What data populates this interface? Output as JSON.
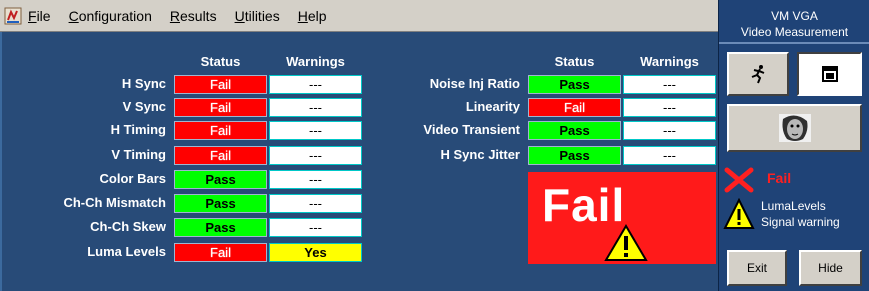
{
  "menu": {
    "items": [
      {
        "u": "F",
        "rest": "ile"
      },
      {
        "u": "C",
        "rest": "onfiguration"
      },
      {
        "u": "R",
        "rest": "esults"
      },
      {
        "u": "U",
        "rest": "tilities"
      },
      {
        "u": "H",
        "rest": "elp"
      }
    ]
  },
  "headers": {
    "status": "Status",
    "warnings": "Warnings"
  },
  "left_rows": [
    {
      "label": "H Sync",
      "status": "Fail",
      "warning": "---"
    },
    {
      "label": "V Sync",
      "status": "Fail",
      "warning": "---"
    },
    {
      "label": "H Timing",
      "status": "Fail",
      "warning": "---"
    },
    {
      "label": "V Timing",
      "status": "Fail",
      "warning": "---"
    },
    {
      "label": "Color Bars",
      "status": "Pass",
      "warning": "---"
    },
    {
      "label": "Ch-Ch Mismatch",
      "status": "Pass",
      "warning": "---"
    },
    {
      "label": "Ch-Ch Skew",
      "status": "Pass",
      "warning": "---"
    },
    {
      "label": "Luma Levels",
      "status": "Fail",
      "warning": "Yes"
    }
  ],
  "right_rows": [
    {
      "label": "Noise Inj Ratio",
      "status": "Pass",
      "warning": "---"
    },
    {
      "label": "Linearity",
      "status": "Fail",
      "warning": "---"
    },
    {
      "label": "Video Transient",
      "status": "Pass",
      "warning": "---"
    },
    {
      "label": "H Sync Jitter",
      "status": "Pass",
      "warning": "---"
    }
  ],
  "overall": {
    "result": "Fail"
  },
  "side_panel": {
    "title_line1": "VM VGA",
    "title_line2": "Video Measurement",
    "run_icon": "running-man-icon",
    "window_icon": "window-icon",
    "face_icon": "face-icon",
    "status_text": "Fail",
    "warning_line1": "LumaLevels",
    "warning_line2": "Signal warning",
    "exit_label": "Exit",
    "hide_label": "Hide"
  },
  "colors": {
    "fail": "#ff0000",
    "pass": "#00ff00",
    "yes": "#ffff00",
    "panel": "#284b78"
  }
}
